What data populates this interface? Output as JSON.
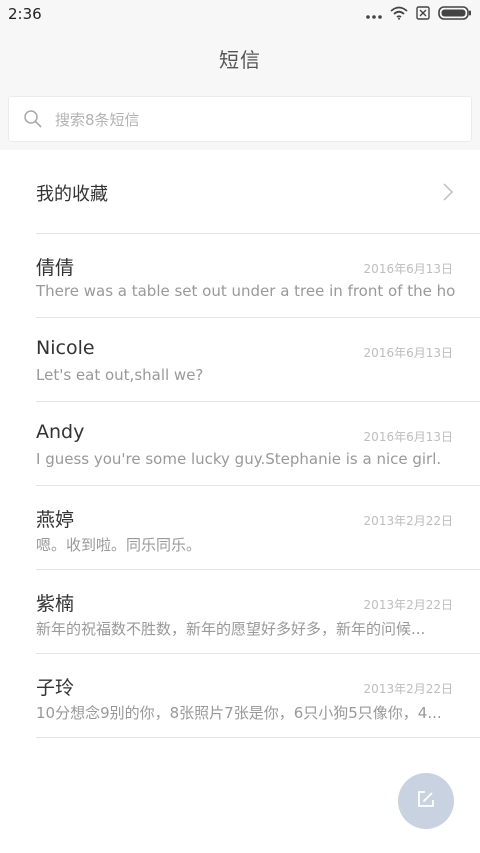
{
  "status_bar": {
    "time": "2:36",
    "icons": [
      "more-dots-icon",
      "wifi-icon",
      "sim-off-icon",
      "battery-icon"
    ]
  },
  "header": {
    "title": "短信"
  },
  "search": {
    "placeholder": "搜索8条短信",
    "icon": "search-icon"
  },
  "favorites": {
    "label": "我的收藏",
    "icon": "chevron-right-icon"
  },
  "conversations": [
    {
      "name": "倩倩",
      "date": "2016年6月13日",
      "preview": "There was a table set out under a tree in front of the ho..."
    },
    {
      "name": "Nicole",
      "date": "2016年6月13日",
      "preview": "Let's eat out,shall we?"
    },
    {
      "name": "Andy",
      "date": "2016年6月13日",
      "preview": "I guess you're some lucky guy.Stephanie is a nice girl."
    },
    {
      "name": "燕婷",
      "date": "2013年2月22日",
      "preview": "嗯。收到啦。同乐同乐。"
    },
    {
      "name": "紫楠",
      "date": "2013年2月22日",
      "preview": "新年的祝福数不胜数，新年的愿望好多好多，新年的问候..."
    },
    {
      "name": "子玲",
      "date": "2013年2月22日",
      "preview": "10分想念9别的你，8张照片7张是你，6只小狗5只像你，4..."
    }
  ],
  "compose_button": {
    "icon": "compose-icon",
    "color": "#c9d2e0"
  }
}
